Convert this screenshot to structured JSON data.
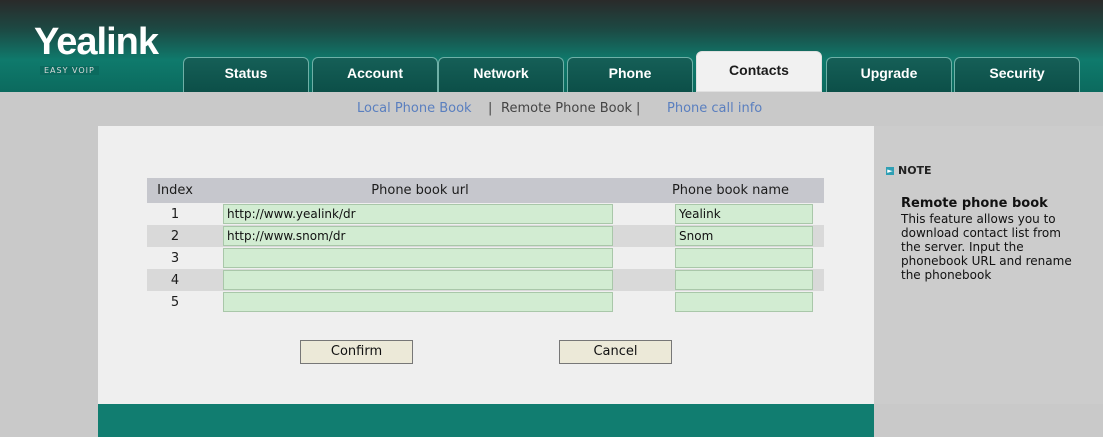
{
  "brand": {
    "logo": "Yealink",
    "tagline": "EASY VOIP"
  },
  "tabs": [
    {
      "label": "Status"
    },
    {
      "label": "Account"
    },
    {
      "label": "Network"
    },
    {
      "label": "Phone"
    },
    {
      "label": "Contacts",
      "active": true
    },
    {
      "label": "Upgrade"
    },
    {
      "label": "Security"
    }
  ],
  "subnav": {
    "local": "Local Phone Book",
    "sep1": "|",
    "remote": "Remote Phone Book",
    "sep2": "|",
    "callinfo": "Phone call info"
  },
  "table": {
    "headers": {
      "index": "Index",
      "url": "Phone book url",
      "name": "Phone book name"
    },
    "rows": [
      {
        "index": "1",
        "url": "http://www.yealink/dr",
        "name": "Yealink"
      },
      {
        "index": "2",
        "url": "http://www.snom/dr",
        "name": "Snom"
      },
      {
        "index": "3",
        "url": "",
        "name": ""
      },
      {
        "index": "4",
        "url": "",
        "name": ""
      },
      {
        "index": "5",
        "url": "",
        "name": ""
      }
    ]
  },
  "buttons": {
    "confirm": "Confirm",
    "cancel": "Cancel"
  },
  "note": {
    "heading": "NOTE",
    "title": "Remote phone book",
    "body": "This feature allows you to download contact list from the server. Input the phonebook URL and rename the phonebook"
  },
  "colors": {
    "header_teal": "#0f7a6c",
    "input_green": "#d2ecd2",
    "footer_teal": "#117d70",
    "link_blue": "#5a7fbf"
  }
}
